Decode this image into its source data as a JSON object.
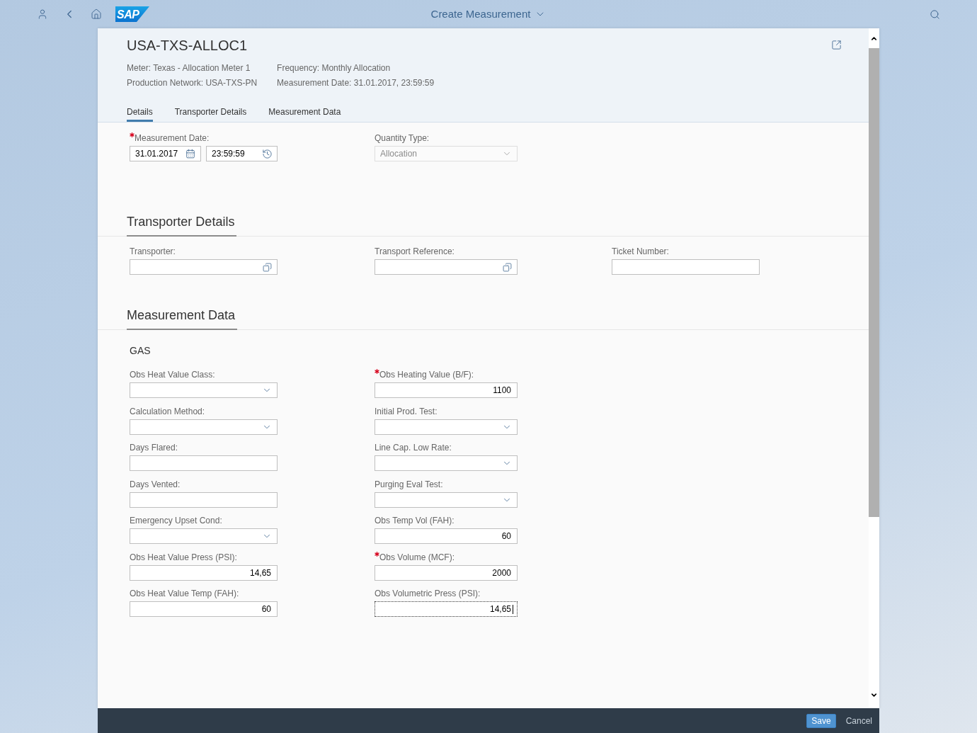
{
  "shell": {
    "logo": "SAP",
    "title": "Create Measurement"
  },
  "header": {
    "title": "USA-TXS-ALLOC1",
    "attribute_columns": [
      [
        "Meter: Texas - Allocation Meter 1",
        "Production Network: USA-TXS-PN"
      ],
      [
        "Frequency: Monthly Allocation",
        "Measurement Date: 31.01.2017, 23:59:59"
      ]
    ]
  },
  "tabs": [
    {
      "label": "Details",
      "selected": true
    },
    {
      "label": "Transporter Details",
      "selected": false
    },
    {
      "label": "Measurement Data",
      "selected": false
    }
  ],
  "sections": [
    {
      "columns": [
        [
          {
            "label": "Measurement Date:",
            "required": true,
            "kind": "datetime",
            "date": "31.01.2017",
            "time": "23:59:59",
            "disabled": false,
            "focused": false
          }
        ],
        [
          {
            "label": "Quantity Type:",
            "required": false,
            "kind": "select",
            "value": "Allocation",
            "disabled": true,
            "focused": false
          }
        ]
      ]
    },
    {
      "title": "Transporter Details",
      "columns": [
        [
          {
            "label": "Transporter:",
            "required": false,
            "kind": "value_help",
            "disabled": false,
            "focused": false
          }
        ],
        [
          {
            "label": "Transport Reference:",
            "required": false,
            "kind": "value_help",
            "disabled": false,
            "focused": false
          }
        ],
        [
          {
            "label": "Ticket Number:",
            "required": false,
            "kind": "input",
            "disabled": false,
            "focused": false
          }
        ]
      ]
    },
    {
      "title": "Measurement Data",
      "group": "GAS",
      "columns": [
        [
          {
            "label": "Obs Heat Value Class:",
            "required": false,
            "kind": "select",
            "disabled": false,
            "focused": false
          },
          {
            "label": "Calculation Method:",
            "required": false,
            "kind": "select",
            "disabled": false,
            "focused": false
          },
          {
            "label": "Days Flared:",
            "required": false,
            "kind": "input",
            "disabled": false,
            "focused": false
          },
          {
            "label": "Days Vented:",
            "required": false,
            "kind": "input",
            "disabled": false,
            "focused": false
          },
          {
            "label": "Emergency Upset Cond:",
            "required": false,
            "kind": "select",
            "disabled": false,
            "focused": false
          },
          {
            "label": "Obs Heat Value Press (PSI):",
            "required": false,
            "kind": "number",
            "value": "14,65",
            "disabled": false,
            "focused": false
          },
          {
            "label": "Obs Heat Value Temp (FAH):",
            "required": false,
            "kind": "number",
            "value": "60",
            "disabled": false,
            "focused": false
          }
        ],
        [
          {
            "label": "Obs Heating Value (B/F):",
            "required": true,
            "kind": "number",
            "value": "1100",
            "disabled": false,
            "focused": false
          },
          {
            "label": "Initial Prod. Test:",
            "required": false,
            "kind": "select",
            "disabled": false,
            "focused": false
          },
          {
            "label": "Line Cap. Low Rate:",
            "required": false,
            "kind": "select",
            "disabled": false,
            "focused": false
          },
          {
            "label": "Purging Eval Test:",
            "required": false,
            "kind": "select",
            "disabled": false,
            "focused": false
          },
          {
            "label": "Obs Temp Vol (FAH):",
            "required": false,
            "kind": "number",
            "value": "60",
            "disabled": false,
            "focused": false
          },
          {
            "label": "Obs Volume (MCF):",
            "required": true,
            "kind": "number",
            "value": "2000",
            "disabled": false,
            "focused": false
          },
          {
            "label": "Obs Volumetric Press (PSI):",
            "required": false,
            "kind": "number",
            "value": "14,65",
            "disabled": false,
            "focused": true
          }
        ]
      ]
    }
  ],
  "footer": {
    "buttons": [
      {
        "label": "Save",
        "kind": "emphasized"
      },
      {
        "label": "Cancel",
        "kind": "transparent"
      }
    ]
  }
}
